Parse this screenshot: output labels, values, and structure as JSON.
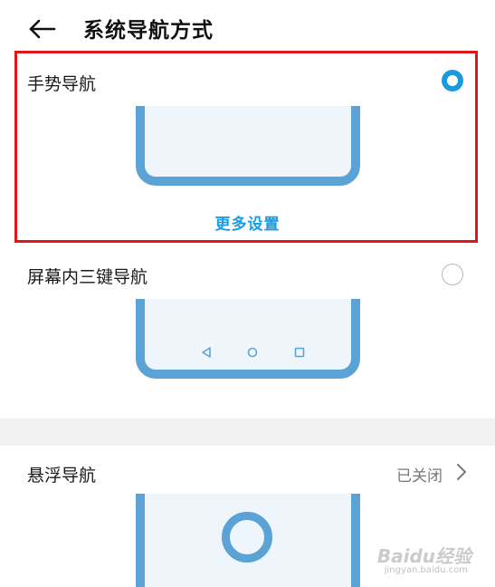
{
  "header": {
    "title": "系统导航方式",
    "back_icon": "arrow-left-icon"
  },
  "options": [
    {
      "label": "手势导航",
      "selected": true,
      "link_label": "更多设置"
    },
    {
      "label": "屏幕内三键导航",
      "selected": false
    },
    {
      "label": "悬浮导航",
      "status": "已关闭"
    }
  ],
  "colors": {
    "accent": "#1a9be0",
    "phone_frame": "#5ba3d6",
    "highlight": "#e0161b",
    "status_text": "#777777"
  },
  "watermark": {
    "text": "Baidu经验",
    "url": "jingyan.baidu.com"
  }
}
